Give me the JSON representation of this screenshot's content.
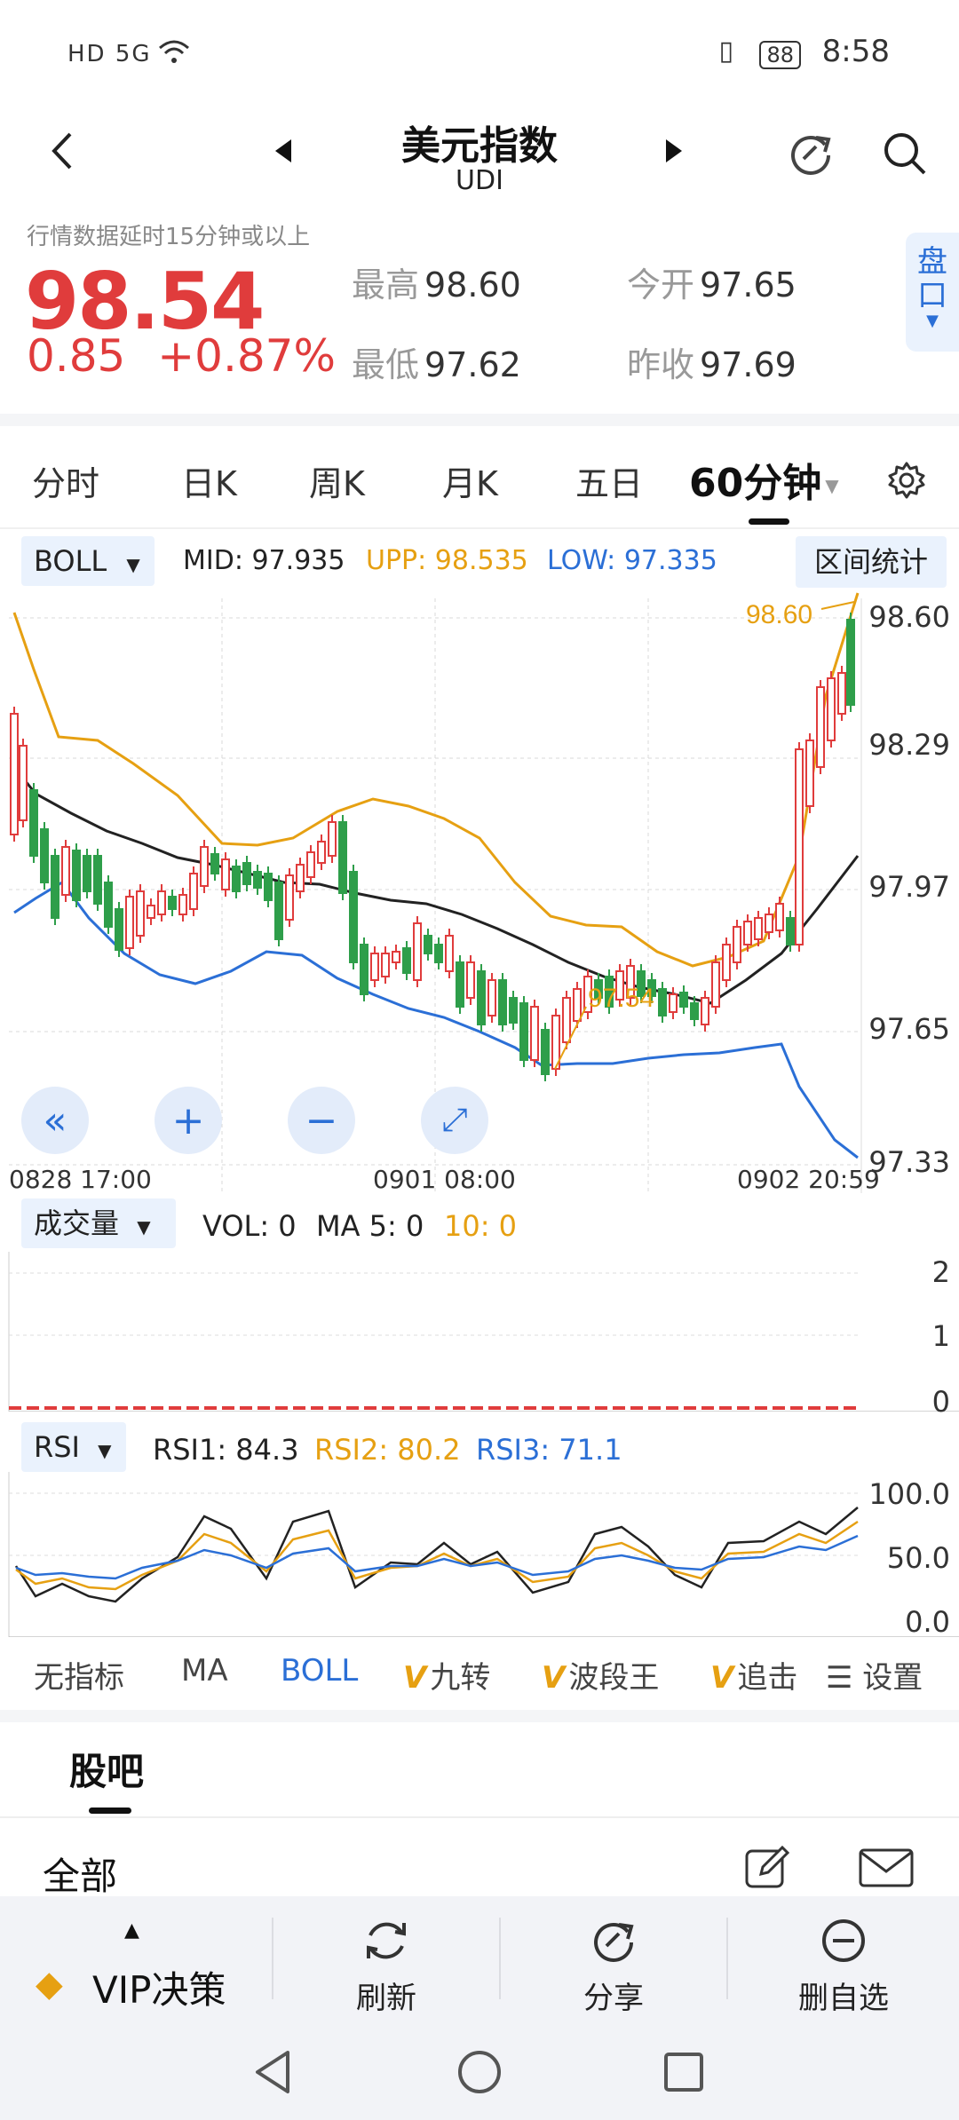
{
  "status_bar": {
    "left_icons": "HD 5G",
    "battery": "88",
    "time": "8:58"
  },
  "header": {
    "title": "美元指数",
    "code": "UDI"
  },
  "quote": {
    "delay_note": "行情数据延时15分钟或以上",
    "price": "98.54",
    "change": "0.85",
    "change_pct": "+0.87%",
    "high_label": "最高",
    "high": "98.60",
    "open_label": "今开",
    "open": "97.65",
    "low_label": "最低",
    "low": "97.62",
    "prev_close_label": "昨收",
    "prev_close": "97.69",
    "pankou_label": "盘口"
  },
  "period_tabs": [
    "分时",
    "日K",
    "周K",
    "月K",
    "五日",
    "60分钟"
  ],
  "indicator_bar": {
    "selected": "BOLL",
    "mid_label": "MID:",
    "mid": "97.935",
    "upp_label": "UPP:",
    "upp": "98.535",
    "low_label": "LOW:",
    "low": "97.335",
    "range_stats": "区间统计"
  },
  "main_chart": {
    "y_ticks": [
      "98.60",
      "98.29",
      "97.97",
      "97.65",
      "97.33"
    ],
    "x_labels": [
      "0828  17:00",
      "0901  08:00",
      "0902  20:59"
    ],
    "max_marker": "98.60",
    "min_marker": "97.54"
  },
  "volume": {
    "selected": "成交量",
    "vol": "VOL: 0",
    "ma5": "MA 5: 0",
    "ma10": "10: 0",
    "y_ticks": [
      "2",
      "1",
      "0"
    ]
  },
  "rsi": {
    "selected": "RSI",
    "rsi1": "RSI1: 84.3",
    "rsi2": "RSI2: 80.2",
    "rsi3": "RSI3: 71.1",
    "y_ticks": [
      "100.0",
      "50.0",
      "0.0"
    ]
  },
  "indicator_tabs": [
    "无指标",
    "MA",
    "BOLL",
    "九转",
    "波段王",
    "追击"
  ],
  "indicator_settings": "设置",
  "community": {
    "title": "股吧",
    "filter": "全部"
  },
  "bottom_bar": {
    "vip": "VIP决策",
    "refresh": "刷新",
    "share": "分享",
    "remove": "删自选"
  },
  "colors": {
    "up_red": "#e03c3c",
    "down_green": "#2e9e4a",
    "accent_blue": "#2b6fd6",
    "orange": "#e6a012"
  },
  "chart_data": {
    "type": "candlestick",
    "series": [
      {
        "name": "MID",
        "values": [
          98.08,
          98.02,
          97.98,
          97.96,
          97.94,
          97.92,
          97.9,
          97.89,
          97.88,
          97.86,
          97.83,
          97.8,
          97.78,
          97.76,
          97.74,
          97.73,
          97.73,
          97.74,
          97.76,
          97.8,
          97.86,
          97.92,
          98.0
        ]
      },
      {
        "name": "UPP",
        "values": [
          98.55,
          98.32,
          98.32,
          98.28,
          98.18,
          98.06,
          98.06,
          98.15,
          98.18,
          98.17,
          98.12,
          98.04,
          97.96,
          97.94,
          97.92,
          97.87,
          97.8,
          97.72,
          97.72,
          97.8,
          98.0,
          98.3,
          98.6
        ]
      },
      {
        "name": "LOW",
        "values": [
          97.95,
          97.98,
          97.85,
          97.8,
          97.82,
          97.81,
          97.78,
          97.7,
          97.65,
          97.58,
          97.55,
          97.59,
          97.6,
          97.6,
          97.62,
          97.63,
          97.62,
          97.62,
          97.63,
          97.62,
          97.42,
          97.35,
          97.3
        ]
      }
    ],
    "ylim": [
      97.33,
      98.6
    ]
  }
}
